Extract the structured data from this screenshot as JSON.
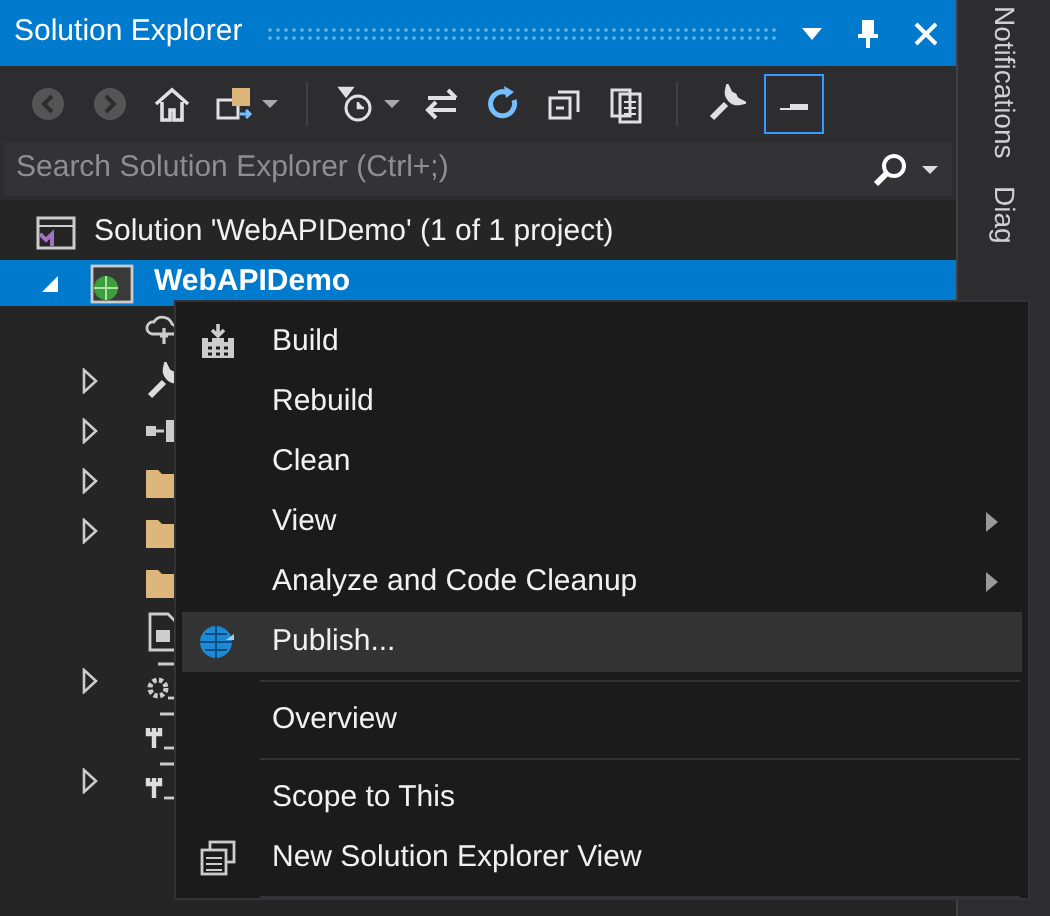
{
  "window": {
    "title": "Solution Explorer"
  },
  "toolbar": [
    {
      "kind": "back",
      "disabled": true,
      "on": false
    },
    {
      "kind": "forward",
      "disabled": true,
      "on": false
    },
    {
      "kind": "home",
      "disabled": false,
      "on": false
    },
    {
      "kind": "switch-views",
      "disabled": false,
      "on": false,
      "dropdown": true
    },
    {
      "kind": "separator"
    },
    {
      "kind": "pending-filter",
      "disabled": false,
      "on": false,
      "dropdown": true
    },
    {
      "kind": "sync",
      "disabled": false,
      "on": false
    },
    {
      "kind": "refresh",
      "disabled": false,
      "on": false
    },
    {
      "kind": "collapse",
      "disabled": false,
      "on": false
    },
    {
      "kind": "show-all",
      "disabled": false,
      "on": false
    },
    {
      "kind": "separator"
    },
    {
      "kind": "properties",
      "disabled": false,
      "on": false
    },
    {
      "kind": "preview",
      "disabled": false,
      "on": true
    }
  ],
  "search": {
    "placeholder": "Search Solution Explorer (Ctrl+;)"
  },
  "tree": {
    "label": "Solution 'WebAPIDemo' (1 of 1 project)",
    "children": [
      {
        "label": "WebAPIDemo",
        "selected": true,
        "expanded": true,
        "children": [
          {
            "kind": "cloud",
            "expandable": false
          },
          {
            "kind": "wrench",
            "expandable": true
          },
          {
            "kind": "references",
            "expandable": true
          },
          {
            "kind": "folder",
            "expandable": true
          },
          {
            "kind": "folder",
            "expandable": true
          },
          {
            "kind": "folder",
            "expandable": false
          },
          {
            "kind": "file",
            "expandable": false
          },
          {
            "kind": "config-gear",
            "expandable": true
          },
          {
            "kind": "config",
            "expandable": false
          },
          {
            "kind": "config",
            "expandable": true
          }
        ]
      }
    ]
  },
  "context_menu": [
    {
      "kind": "build",
      "label": "Build",
      "submenu": false,
      "selected": false
    },
    {
      "kind": "item",
      "label": "Rebuild",
      "submenu": false,
      "selected": false
    },
    {
      "kind": "item",
      "label": "Clean",
      "submenu": false,
      "selected": false
    },
    {
      "kind": "item",
      "label": "View",
      "submenu": true,
      "selected": false
    },
    {
      "kind": "item",
      "label": "Analyze and Code Cleanup",
      "submenu": true,
      "selected": false
    },
    {
      "kind": "globe",
      "label": "Publish...",
      "submenu": false,
      "selected": true
    },
    {
      "kind": "separator"
    },
    {
      "kind": "item",
      "label": "Overview",
      "submenu": false,
      "selected": false
    },
    {
      "kind": "separator"
    },
    {
      "kind": "item",
      "label": "Scope to This",
      "submenu": false,
      "selected": false
    },
    {
      "kind": "windows",
      "label": "New Solution Explorer View",
      "submenu": false,
      "selected": false
    },
    {
      "kind": "separator"
    }
  ],
  "side_tabs": [
    "Notifications",
    "Diag"
  ]
}
